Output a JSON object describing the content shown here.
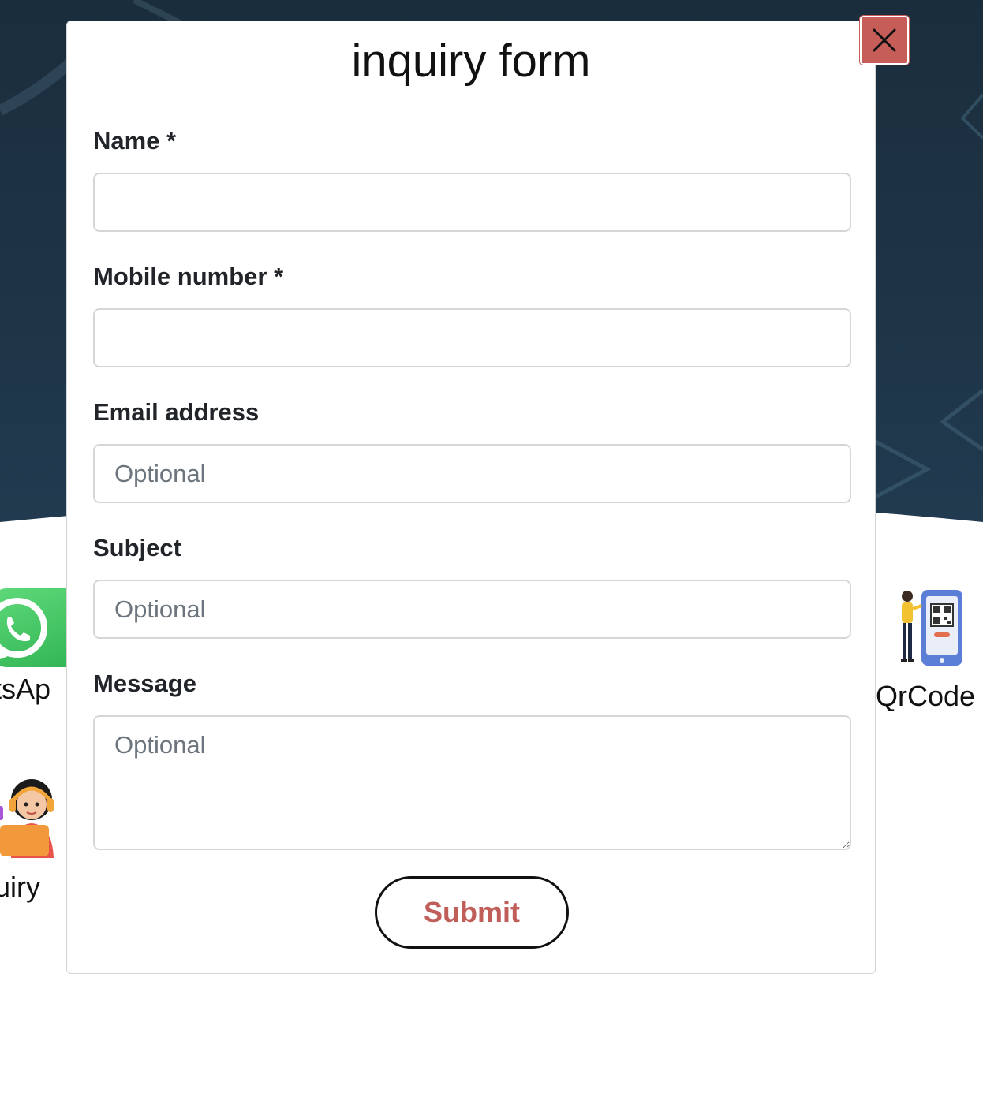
{
  "modal": {
    "title": "inquiry form",
    "close_icon": "close-icon",
    "fields": {
      "name": {
        "label": "Name *",
        "placeholder": ""
      },
      "mobile": {
        "label": "Mobile number *",
        "placeholder": ""
      },
      "email": {
        "label": "Email address",
        "placeholder": "Optional"
      },
      "subject": {
        "label": "Subject",
        "placeholder": "Optional"
      },
      "message": {
        "label": "Message",
        "placeholder": "Optional"
      }
    },
    "submit_label": "Submit"
  },
  "background": {
    "tiles": [
      {
        "label": "atsAp",
        "icon": "whatsapp-icon"
      },
      {
        "label": "QrCode",
        "icon": "qrcode-icon"
      },
      {
        "label": "quiry",
        "icon": "support-agent-icon"
      }
    ]
  },
  "colors": {
    "hero_bg": "#1d3244",
    "accent": "#c65d58",
    "submit_text": "#c05f5a",
    "whatsapp_green": "#2fb352"
  }
}
